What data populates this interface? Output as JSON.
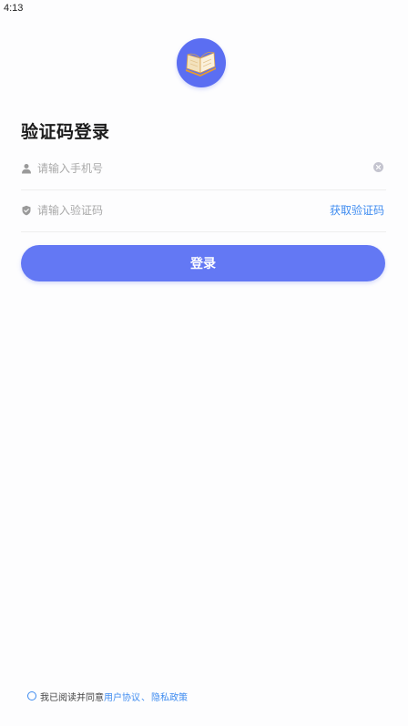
{
  "status_bar": {
    "time": "4:13"
  },
  "logo": {
    "icon": "open-book-icon",
    "bg_color": "#5b6ef2"
  },
  "title": "验证码登录",
  "phone_field": {
    "placeholder": "请输入手机号",
    "value": "",
    "icon": "user-icon",
    "clear_icon": "clear-icon"
  },
  "code_field": {
    "placeholder": "请输入验证码",
    "value": "",
    "icon": "shield-icon",
    "get_code_label": "获取验证码"
  },
  "login_button": {
    "label": "登录",
    "color": "#6378f4"
  },
  "agreement": {
    "text": "我已阅读并同意",
    "user_agreement": "用户协议",
    "separator": "、",
    "privacy_policy": "隐私政策",
    "checked": false
  },
  "colors": {
    "accent": "#3f8cf0",
    "primary": "#6378f4"
  }
}
